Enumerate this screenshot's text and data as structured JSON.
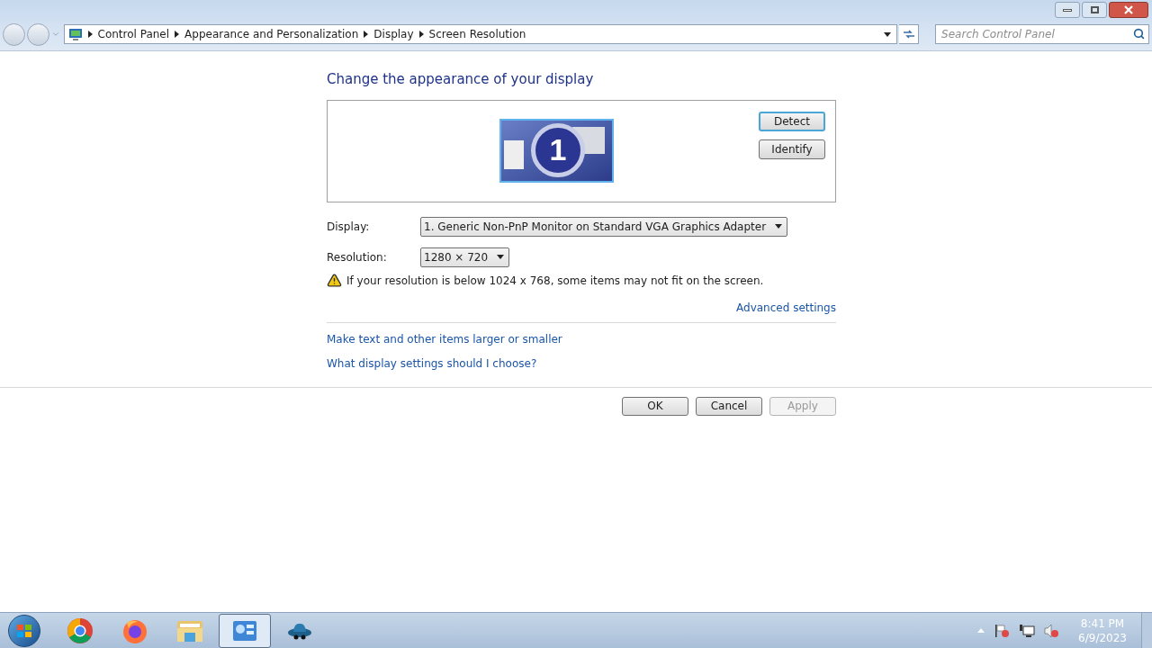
{
  "address_bar": {
    "breadcrumb": [
      "Control Panel",
      "Appearance and Personalization",
      "Display",
      "Screen Resolution"
    ]
  },
  "search": {
    "placeholder": "Search Control Panel"
  },
  "heading": "Change the appearance of your display",
  "monitor": {
    "number": "1"
  },
  "monitor_buttons": [
    {
      "label": "Detect",
      "focused": true
    },
    {
      "label": "Identify",
      "focused": false
    }
  ],
  "settings": [
    {
      "label": "Display:",
      "value": "1. Generic Non-PnP Monitor on Standard VGA Graphics Adapter"
    },
    {
      "label": "Resolution:",
      "value": "1280 × 720"
    }
  ],
  "warning": "If your resolution is below 1024 x 768, some items may not fit on the screen.",
  "advanced_link": "Advanced settings",
  "links": [
    "Make text and other items larger or smaller",
    "What display settings should I choose?"
  ],
  "dialog_buttons": [
    {
      "label": "OK",
      "disabled": false
    },
    {
      "label": "Cancel",
      "disabled": false
    },
    {
      "label": "Apply",
      "disabled": true
    }
  ],
  "taskbar": {
    "apps": [
      {
        "kind": "chrome",
        "selected": false
      },
      {
        "kind": "firefox",
        "selected": false
      },
      {
        "kind": "folder",
        "selected": false
      },
      {
        "kind": "control-panel",
        "selected": true
      },
      {
        "kind": "game",
        "selected": false
      }
    ],
    "clock": {
      "time": "8:41 PM",
      "date": "6/9/2023"
    }
  }
}
